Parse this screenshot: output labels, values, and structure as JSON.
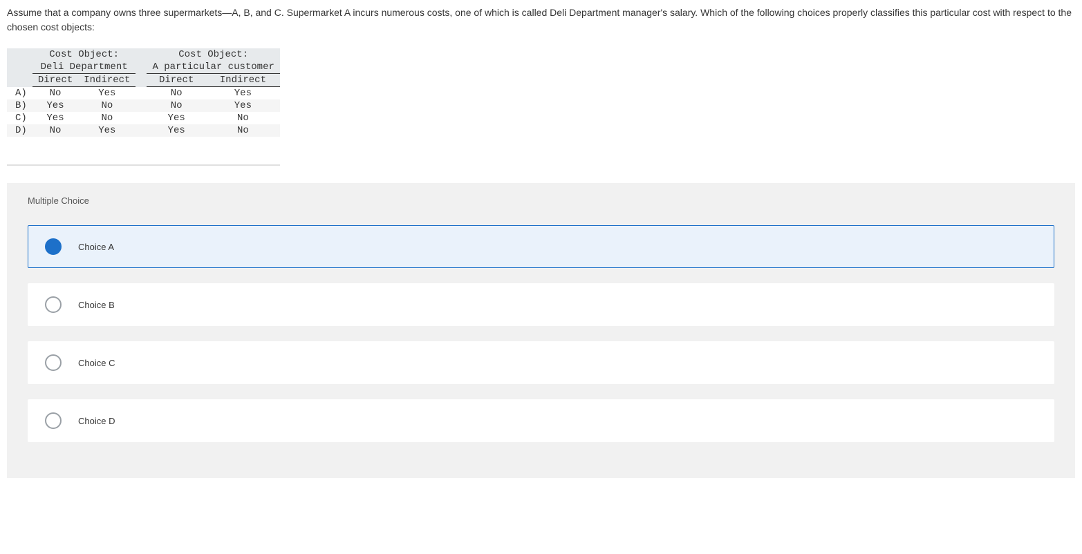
{
  "question": "Assume that a company owns three supermarkets—A, B, and C. Supermarket A incurs numerous costs, one of which is called Deli Department manager's salary. Which of the following choices properly classifies this particular cost with respect to the chosen cost objects:",
  "table": {
    "cost_object_title": "Cost Object:",
    "col1_name": "Deli Department",
    "col2_name": "A particular customer",
    "sub_direct": "Direct",
    "sub_indirect": "Indirect",
    "rows": [
      {
        "label": "A)",
        "c1d": "No",
        "c1i": "Yes",
        "c2d": "No",
        "c2i": "Yes"
      },
      {
        "label": "B)",
        "c1d": "Yes",
        "c1i": "No",
        "c2d": "No",
        "c2i": "Yes"
      },
      {
        "label": "C)",
        "c1d": "Yes",
        "c1i": "No",
        "c2d": "Yes",
        "c2i": "No"
      },
      {
        "label": "D)",
        "c1d": "No",
        "c1i": "Yes",
        "c2d": "Yes",
        "c2i": "No"
      }
    ]
  },
  "answer_section": {
    "heading": "Multiple Choice",
    "choices": [
      {
        "label": "Choice A",
        "selected": true
      },
      {
        "label": "Choice B",
        "selected": false
      },
      {
        "label": "Choice C",
        "selected": false
      },
      {
        "label": "Choice D",
        "selected": false
      }
    ]
  }
}
